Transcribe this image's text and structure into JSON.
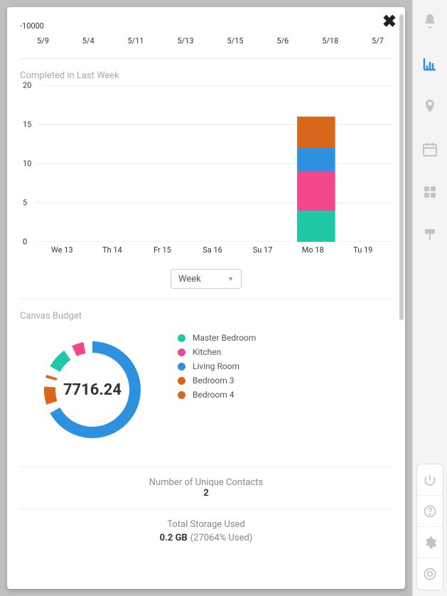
{
  "top_chart_remnant": {
    "y_tick": "-10000",
    "x_ticks": [
      "5/9",
      "5/4",
      "5/11",
      "5/13",
      "5/15",
      "5/6",
      "5/18",
      "5/7"
    ]
  },
  "bar_section": {
    "title": "Completed in Last Week",
    "dropdown_value": "Week"
  },
  "donut_section": {
    "title": "Canvas Budget",
    "center_value": "7716.24",
    "legend": [
      {
        "label": "Master Bedroom",
        "color": "#21c7a6"
      },
      {
        "label": "Kitchen",
        "color": "#f2478b"
      },
      {
        "label": "Living Room",
        "color": "#2d91e0"
      },
      {
        "label": "Bedroom 3",
        "color": "#d8661b"
      },
      {
        "label": "Bedroom 4",
        "color": "#d8661b"
      }
    ]
  },
  "stats": {
    "contacts_label": "Number of Unique Contacts",
    "contacts_value": "2",
    "storage_label": "Total Storage Used",
    "storage_value": "0.2 GB",
    "storage_pct": "(27064% Used)"
  },
  "chart_data": [
    {
      "type": "bar",
      "title": "Completed in Last Week",
      "stacked": true,
      "categories": [
        "We 13",
        "Th 14",
        "Fr 15",
        "Sa 16",
        "Su 17",
        "Mo 18",
        "Tu 19"
      ],
      "series": [
        {
          "name": "Master Bedroom",
          "color": "#21c7a6",
          "values": [
            0,
            0,
            0,
            0,
            0,
            4,
            0
          ]
        },
        {
          "name": "Kitchen",
          "color": "#f2478b",
          "values": [
            0,
            0,
            0,
            0,
            0,
            5,
            0
          ]
        },
        {
          "name": "Living Room",
          "color": "#2d91e0",
          "values": [
            0,
            0,
            0,
            0,
            0,
            3,
            0
          ]
        },
        {
          "name": "Bedroom 3",
          "color": "#d8661b",
          "values": [
            0,
            0,
            0,
            0,
            0,
            2,
            0
          ]
        },
        {
          "name": "Bedroom 4",
          "color": "#d8661b",
          "values": [
            0,
            0,
            0,
            0,
            0,
            2,
            0
          ]
        }
      ],
      "ylim": [
        0,
        20
      ],
      "y_ticks": [
        0,
        5,
        10,
        15,
        20
      ],
      "xlabel": "",
      "ylabel": ""
    },
    {
      "type": "pie",
      "title": "Canvas Budget",
      "total": 7716.24,
      "series": [
        {
          "name": "Living Room",
          "color": "#2d91e0",
          "value": 5401
        },
        {
          "name": "Bedroom 3",
          "color": "#d8661b",
          "value": 695
        },
        {
          "name": "Bedroom 4",
          "color": "#d8661b",
          "value": 309
        },
        {
          "name": "Master Bedroom",
          "color": "#21c7a6",
          "value": 772
        },
        {
          "name": "Kitchen",
          "color": "#f2478b",
          "value": 540
        }
      ]
    }
  ]
}
